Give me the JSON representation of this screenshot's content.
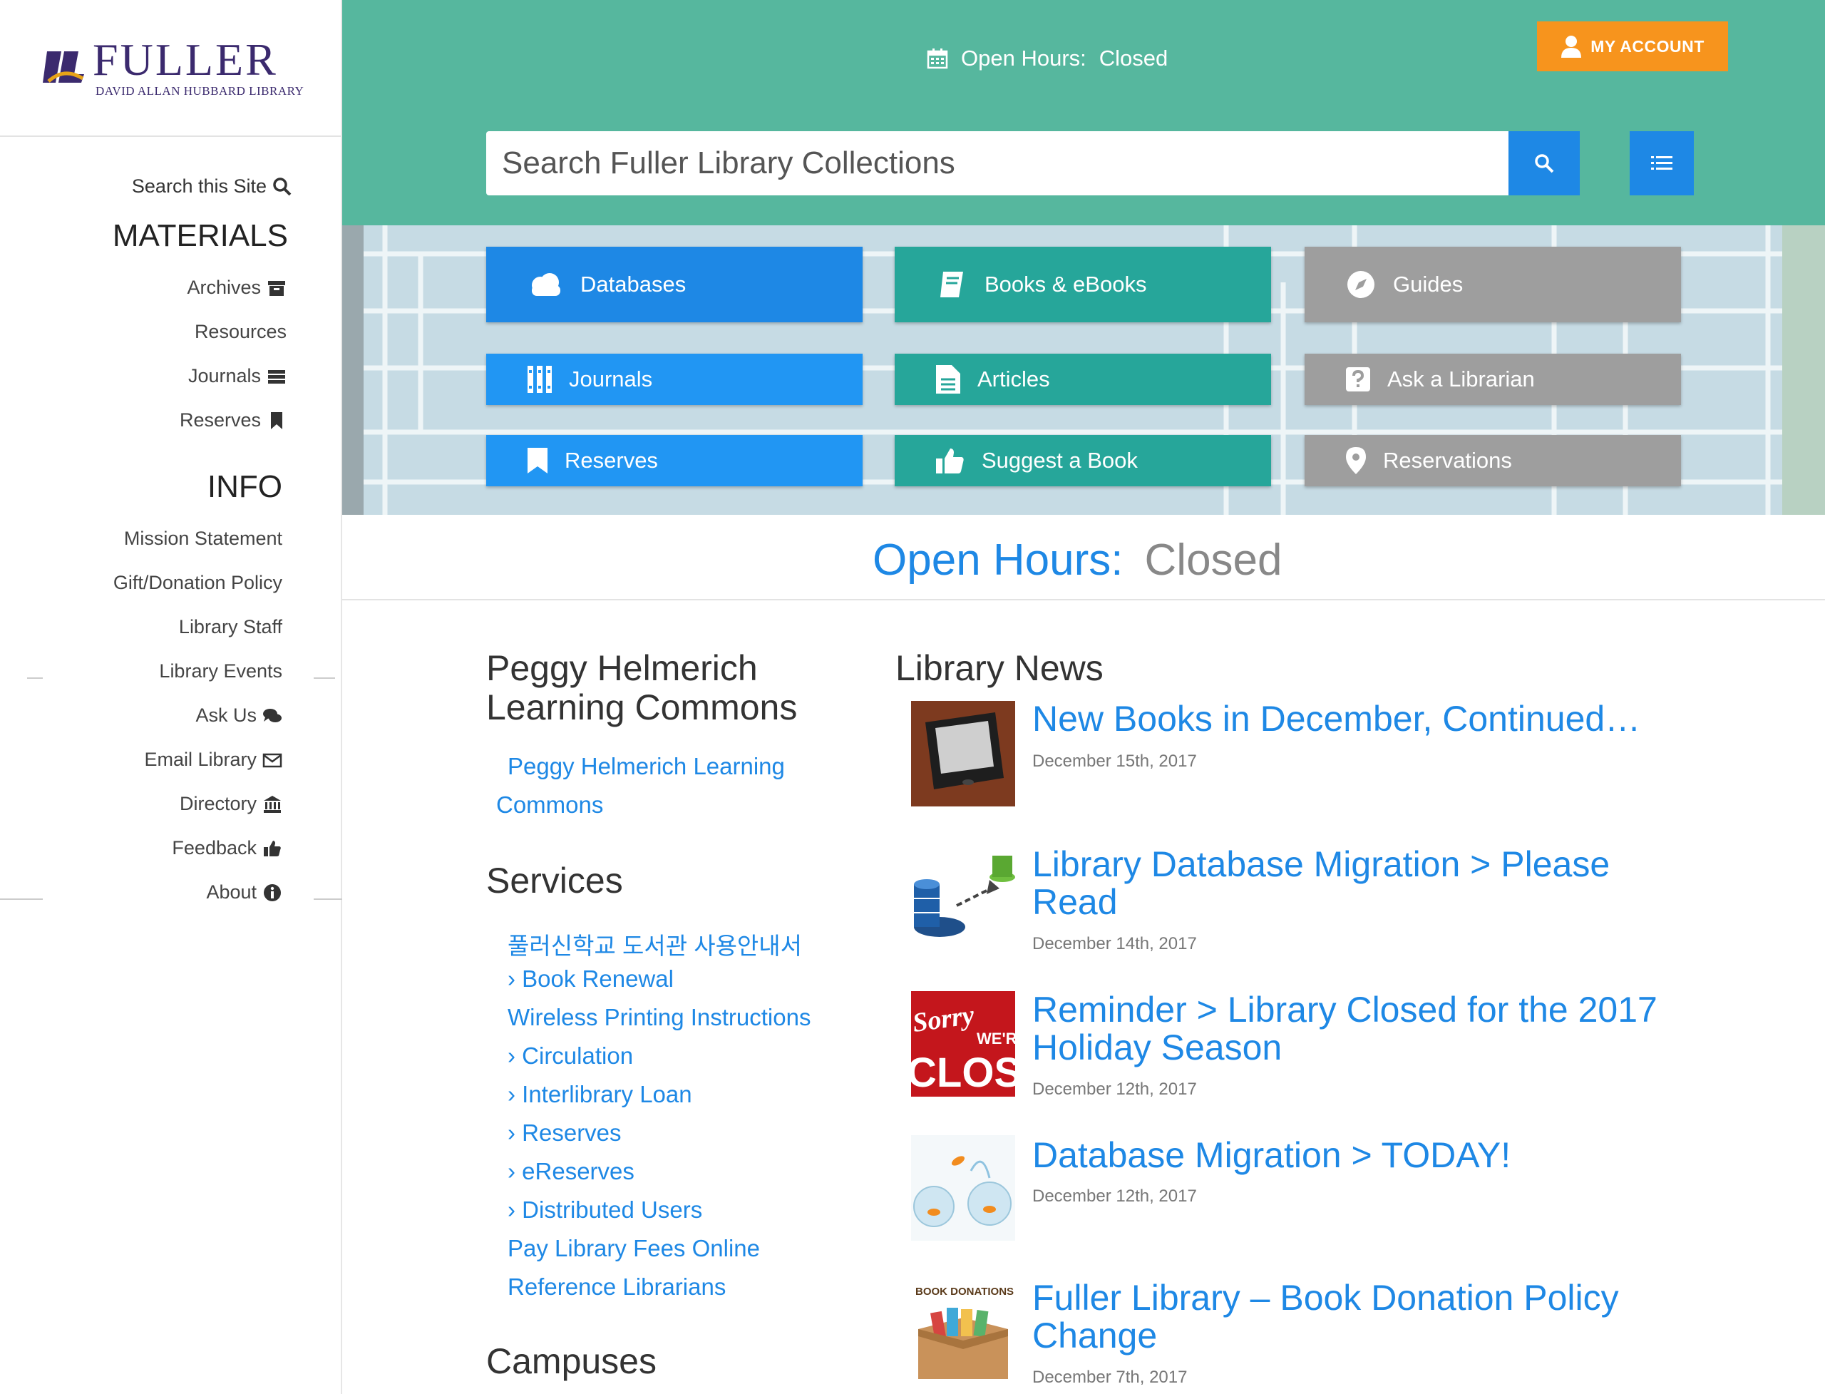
{
  "sidebar": {
    "logo_title": "FULLER",
    "logo_subtitle": "DAVID ALLAN HUBBARD LIBRARY",
    "search_label": "Search this Site",
    "materials_heading": "MATERIALS",
    "materials": [
      "Archives",
      "Resources",
      "Journals",
      "Reserves"
    ],
    "info_heading": "INFO",
    "info": [
      "Mission Statement",
      "Gift/Donation Policy",
      "Library Staff",
      "Library Events",
      "Ask Us",
      "Email Library",
      "Directory",
      "Feedback",
      "About"
    ]
  },
  "header": {
    "hours_label": "Open Hours:",
    "hours_value": "Closed",
    "account_label": "MY ACCOUNT",
    "search_placeholder": "Search Fuller Library Collections"
  },
  "tiles": [
    "Databases",
    "Books & eBooks",
    "Guides",
    "Journals",
    "Articles",
    "Ask a Librarian",
    "Reserves",
    "Suggest a Book",
    "Reservations"
  ],
  "hours_banner": {
    "label": "Open Hours:",
    "value": "Closed"
  },
  "learning_commons": {
    "heading_line1": "Peggy Helmerich",
    "heading_line2": "Learning Commons",
    "link_line1": "Peggy Helmerich Learning",
    "link_line2": "Commons"
  },
  "services": {
    "heading": "Services",
    "links": [
      "풀러신학교 도서관 사용안내서",
      "› Book Renewal",
      "Wireless Printing Instructions",
      "› Circulation",
      "› Interlibrary Loan",
      "› Reserves",
      "› eReserves",
      "› Distributed Users",
      "Pay Library Fees Online",
      "Reference Librarians"
    ]
  },
  "campuses_heading": "Campuses",
  "news": {
    "heading": "Library News",
    "items": [
      {
        "title_line1": "New Books in December, Continued…",
        "title_line2": "",
        "date": "December 15th, 2017"
      },
      {
        "title_line1": "Library Database Migration > Please",
        "title_line2": "Read",
        "date": "December 14th, 2017"
      },
      {
        "title_line1": "Reminder > Library Closed for the 2017",
        "title_line2": "Holiday Season",
        "date": "December 12th, 2017"
      },
      {
        "title_line1": "Database Migration > TODAY!",
        "title_line2": "",
        "date": "December 12th, 2017"
      },
      {
        "title_line1": "Fuller Library – Book Donation Policy",
        "title_line2": "Change",
        "date": "December 7th, 2017"
      }
    ],
    "thumb_texts": {
      "sorry": "Sorry",
      "were": "WE'R",
      "closed": "CLOSED",
      "book_donations": "BOOK DONATIONS"
    }
  },
  "colors": {
    "teal_band": "#56b79e",
    "blue": "#1e88e5",
    "teal": "#26a69a",
    "gray": "#9e9e9e",
    "orange": "#f7941d",
    "logo_purple": "#3b2a6e"
  }
}
